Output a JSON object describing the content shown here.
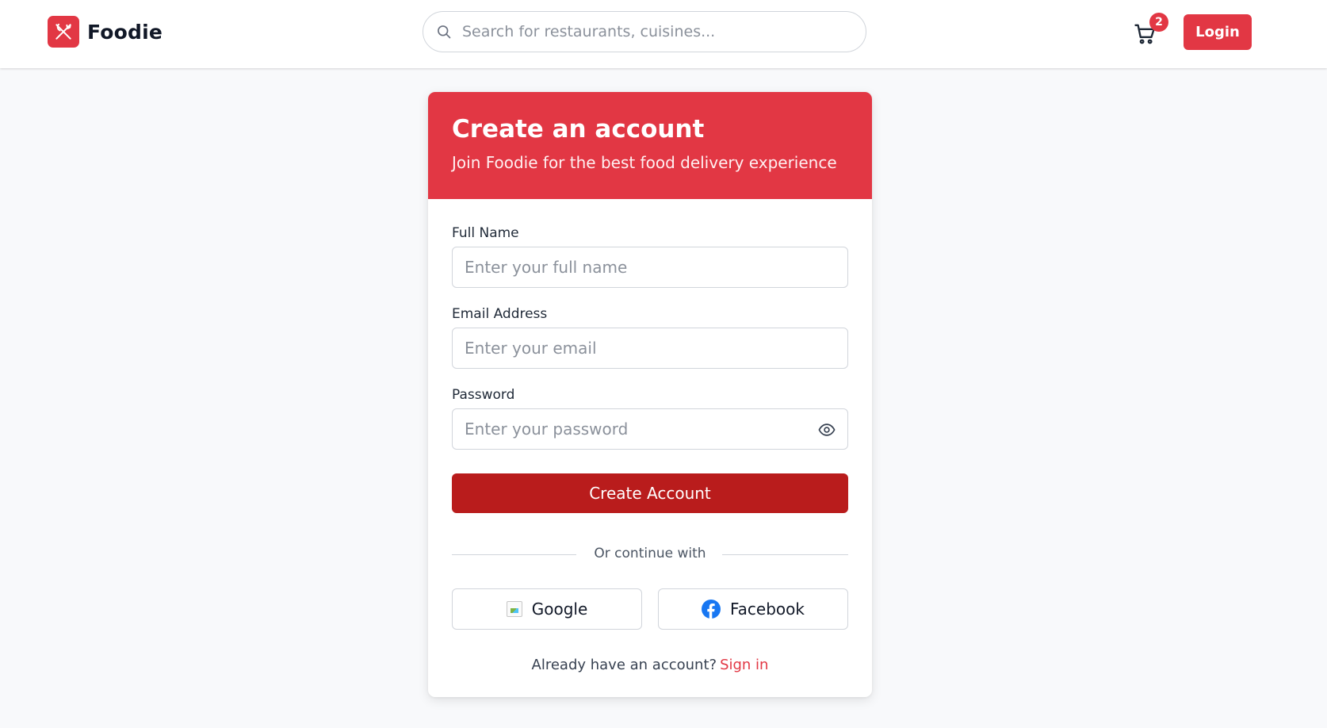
{
  "colors": {
    "brand": "#e23744",
    "primary_button": "#b91c1c",
    "background": "#f8f9fb",
    "facebook": "#1877f2"
  },
  "header": {
    "brand_name": "Foodie",
    "brand_icon": "fork-knife-icon",
    "search": {
      "placeholder": "Search for restaurants, cuisines...",
      "value": ""
    },
    "cart": {
      "icon": "shopping-cart-icon",
      "badge_count": "2"
    },
    "login_label": "Login"
  },
  "signup": {
    "title": "Create an account",
    "subtitle": "Join Foodie for the best food delivery experience",
    "full_name": {
      "label": "Full Name",
      "placeholder": "Enter your full name",
      "value": ""
    },
    "email": {
      "label": "Email Address",
      "placeholder": "Enter your email",
      "value": ""
    },
    "password": {
      "label": "Password",
      "placeholder": "Enter your password",
      "value": "",
      "toggle_icon": "eye-icon"
    },
    "submit_label": "Create Account",
    "divider_text": "Or continue with",
    "social": {
      "google_label": "Google",
      "facebook_label": "Facebook"
    },
    "footer": {
      "prompt": "Already have an account?",
      "link_label": "Sign in"
    }
  }
}
